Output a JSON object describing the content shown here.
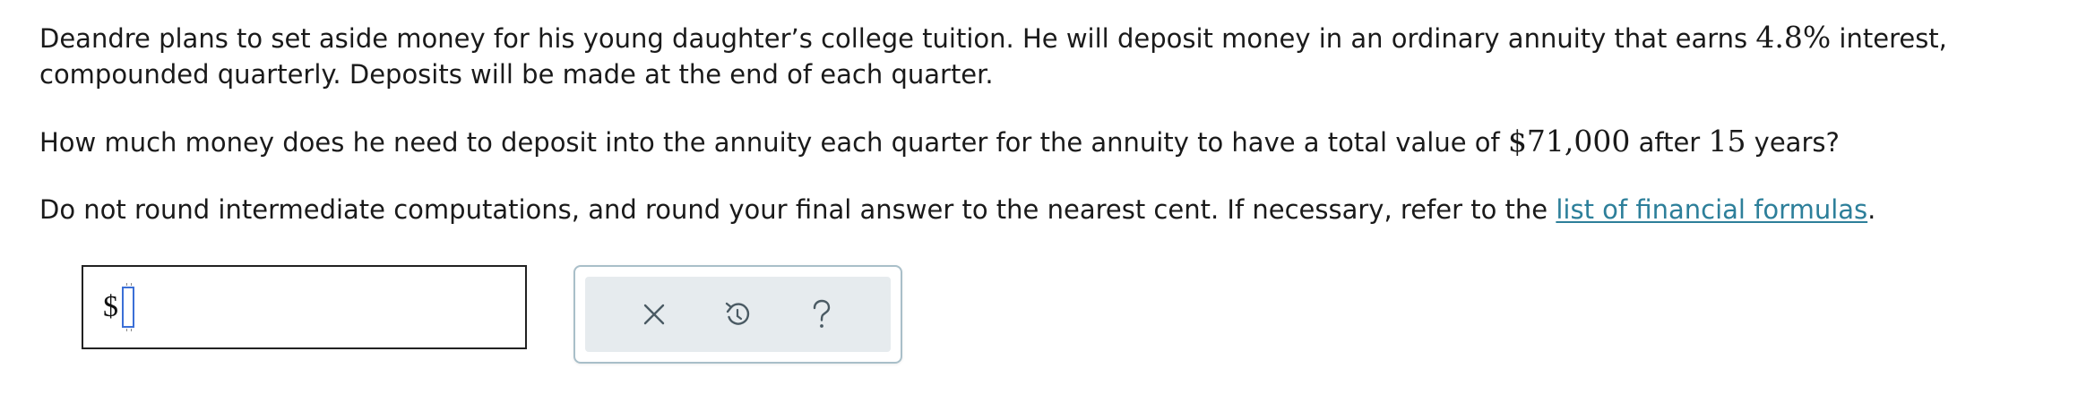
{
  "problem": {
    "p1_a": "Deandre plans to set aside money for his young daughter’s college tuition. He will deposit money in an ordinary annuity that earns ",
    "p1_rate": "4.8%",
    "p1_b": " interest, compounded quarterly. Deposits will be made at the end of each quarter.",
    "p2_a": "How much money does he need to deposit into the annuity each quarter for the annuity to have a total value of ",
    "p2_amount": "$71,000",
    "p2_b": " after ",
    "p2_years": "15",
    "p2_c": " years?",
    "p3_a": "Do not round intermediate computations, and round your final answer to the nearest cent. If necessary, refer to the ",
    "p3_link": "list of financial formulas",
    "p3_b": "."
  },
  "answer": {
    "prefix": "$",
    "value": ""
  },
  "toolbar": {
    "buttons": [
      {
        "icon": "close-icon"
      },
      {
        "icon": "undo-icon"
      },
      {
        "icon": "help-icon"
      }
    ]
  },
  "colors": {
    "link": "#2d7f9a",
    "toolbar_bg": "#e6ebee",
    "toolbar_border": "#a9bfc9",
    "icon": "#4a5a63",
    "cursor": "#3b6fd6"
  }
}
